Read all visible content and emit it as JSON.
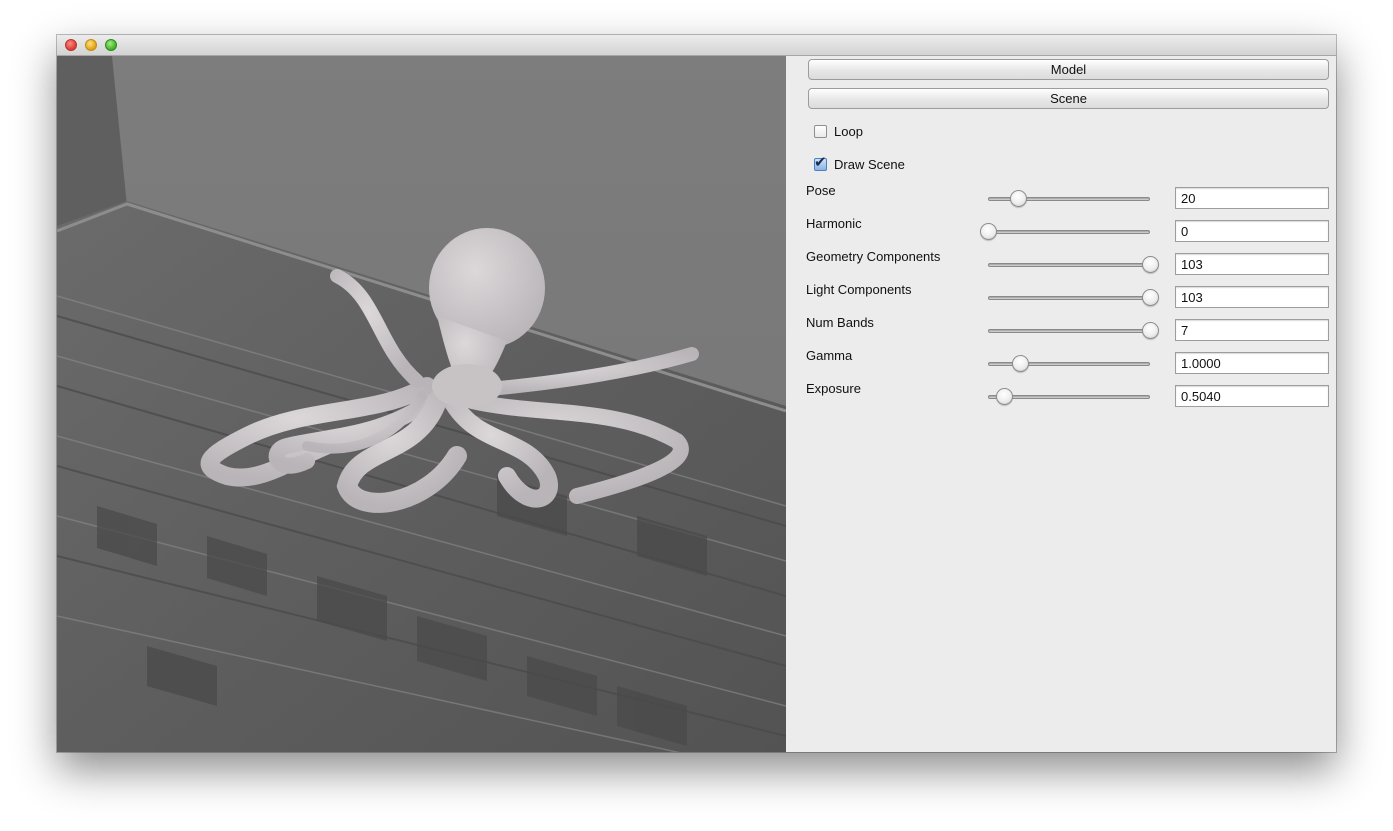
{
  "window": {
    "controls": [
      "close",
      "minimize",
      "zoom"
    ]
  },
  "viewport": {
    "content": "octopus-model-render"
  },
  "panel": {
    "buttons": {
      "model": "Model",
      "scene": "Scene"
    },
    "checkboxes": {
      "loop": {
        "label": "Loop",
        "checked": false
      },
      "draw_scene": {
        "label": "Draw Scene",
        "checked": true
      }
    },
    "params": [
      {
        "label": "Pose",
        "value": "20",
        "level": 0.19
      },
      {
        "label": "Harmonic",
        "value": "0",
        "level": 0.0
      },
      {
        "label": "Geometry Components",
        "value": "103",
        "level": 1.0
      },
      {
        "label": "Light Components",
        "value": "103",
        "level": 1.0
      },
      {
        "label": "Num Bands",
        "value": "7",
        "level": 1.0
      },
      {
        "label": "Gamma",
        "value": "1.0000",
        "level": 0.2
      },
      {
        "label": "Exposure",
        "value": "0.5040",
        "level": 0.1
      }
    ]
  }
}
